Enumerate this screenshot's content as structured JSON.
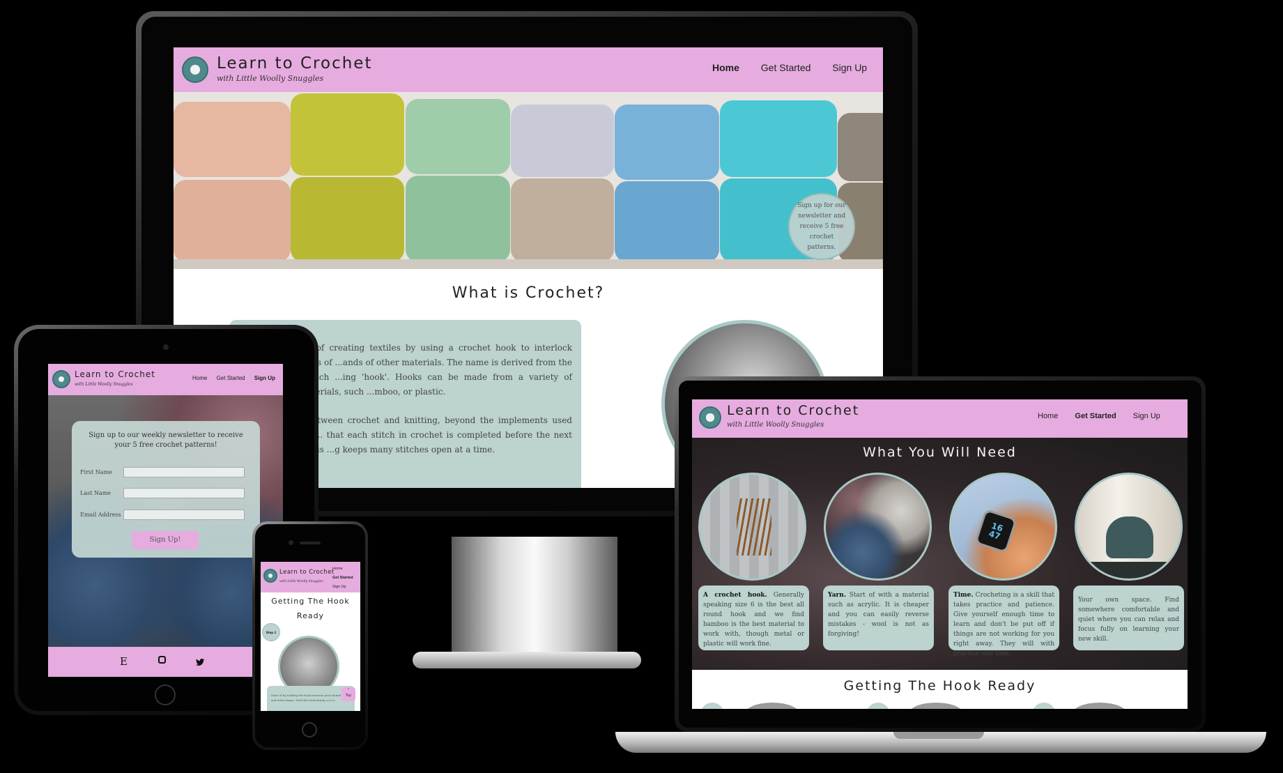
{
  "brand": {
    "title": "Learn to Crochet",
    "subtitle": "with Little Woolly Snuggles"
  },
  "nav": {
    "home": "Home",
    "get_started": "Get Started",
    "sign_up": "Sign Up"
  },
  "desktop": {
    "hero_badge": "Sign up for our newsletter and receive 5 free crochet patterns.",
    "section_title": "What is Crochet?",
    "para1": "...s of creating textiles by using a crochet hook to interlock loops of ...ands of other materials. The name is derived from the French ...ing 'hook'. Hooks can be made from a variety of materials, such ...mboo, or plastic.",
    "para2": "...between crochet and knitting, beyond the implements used for ... that each stitch in crochet is completed before the next one is ...g keeps many stitches open at a time."
  },
  "tablet": {
    "form_title": "Sign up to our weekly newsletter to receive your 5 free crochet patterns!",
    "first_name": "First Name",
    "last_name": "Last Name",
    "email": "Email Address",
    "submit": "Sign Up!",
    "footer_icons": [
      "etsy-icon",
      "instagram-icon",
      "twitter-icon"
    ],
    "etsy_glyph": "E"
  },
  "phone": {
    "section_title": "Getting The Hook Ready",
    "step_label": "Step 1",
    "step_text": "Start of by holding the hook between your thumb and index finger. Hold the hook firmly so it is",
    "top_button": "Top"
  },
  "laptop": {
    "section_title": "What You Will Need",
    "next_section_title": "Getting The Hook Ready",
    "cards": [
      {
        "bold": "A crochet hook.",
        "text": " Generally speaking size 6 is the best all round hook and we find bamboo is the best material to work with, though metal or plastic will work fine."
      },
      {
        "bold": "Yarn.",
        "text": " Start of with a material such as acrylic. It is cheaper and you can easily reverse mistakes - wool is not as forgiving!"
      },
      {
        "bold": "Time.",
        "text": " Crocheting is a skill that takes practice and patience. Give yourself enough time to learn and don't be put off if things are not working for you right away. They will with practice and time."
      },
      {
        "bold": "",
        "text": "Your own space. Find somewhere comfortable and quiet where you can relax and focus fully on learning your new skill."
      }
    ],
    "watch_time": "16 47"
  }
}
